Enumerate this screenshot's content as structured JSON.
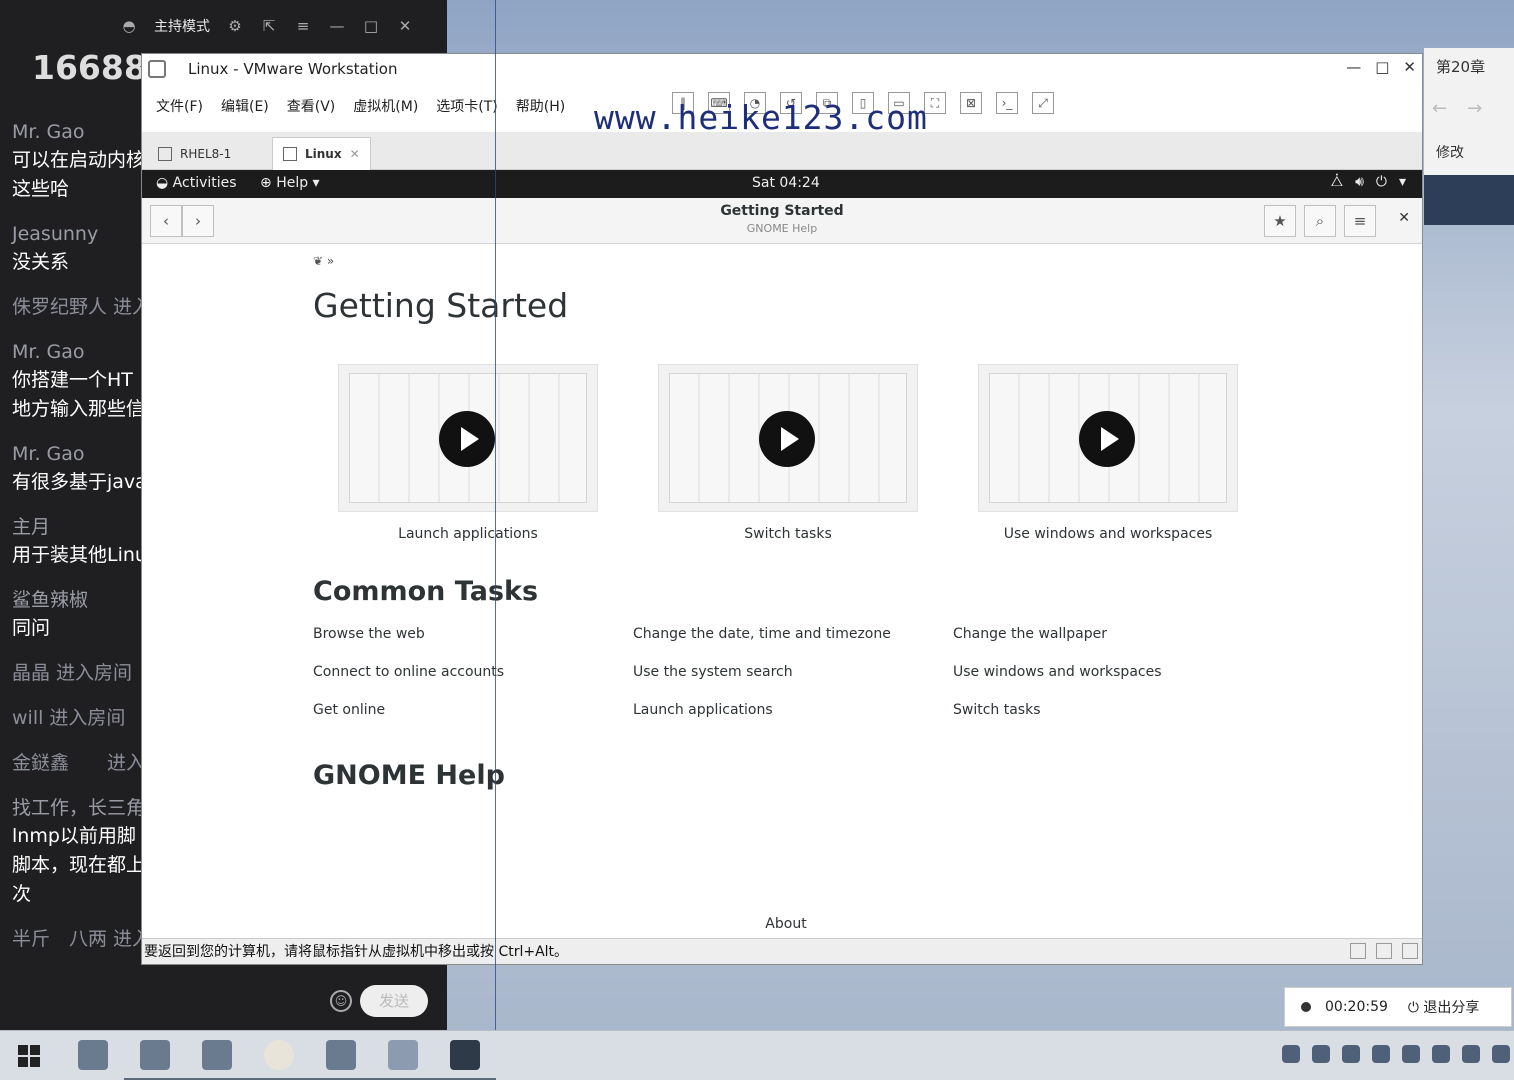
{
  "chat": {
    "toolbar_mode": "主持模式",
    "room_id": "16688",
    "messages": [
      {
        "user": "Mr. Gao",
        "text": "可以在启动内核",
        "text2": "这些哈"
      },
      {
        "user": "Jeasunny",
        "text": "没关系"
      },
      {
        "system": "侏罗纪野人 进入"
      },
      {
        "user": "Mr. Gao",
        "text": "你搭建一个HT",
        "text2": "地方输入那些信"
      },
      {
        "user": "Mr. Gao",
        "text": "有很多基于java"
      },
      {
        "user": "主月",
        "text": "用于装其他Linu"
      },
      {
        "user": "鲨鱼辣椒",
        "text": "同问"
      },
      {
        "system": "晶晶 进入房间"
      },
      {
        "system": "will 进入房间"
      },
      {
        "system": "金鎹鑫　　进入"
      },
      {
        "user": "找工作，长三角",
        "text": "lnmp以前用脚",
        "text2": "脚本，现在都上",
        "text3": "次"
      },
      {
        "system": "半斤　八两 进入"
      }
    ],
    "send_label": "发送"
  },
  "side_panel": {
    "title": "第20章",
    "edit_label": "修改"
  },
  "vmware": {
    "title": "Linux - VMware Workstation",
    "menu": [
      "文件(F)",
      "编辑(E)",
      "查看(V)",
      "虚拟机(M)",
      "选项卡(T)",
      "帮助(H)"
    ],
    "watermark": "www.heike123.com",
    "tabs": [
      {
        "label": "RHEL8-1"
      },
      {
        "label": "Linux"
      }
    ],
    "status_text": "要返回到您的计算机，请将鼠标指针从虚拟机中移出或按 Ctrl+Alt。"
  },
  "gnome": {
    "activities": "Activities",
    "help_menu": "Help ▾",
    "clock": "Sat 04:24"
  },
  "help_app": {
    "header_title": "Getting Started",
    "header_subtitle": "GNOME Help",
    "trail": "» ",
    "page_title": "Getting Started",
    "videos": [
      {
        "caption": "Launch applications"
      },
      {
        "caption": "Switch tasks"
      },
      {
        "caption": "Use windows and workspaces"
      }
    ],
    "common_tasks_title": "Common Tasks",
    "tasks": {
      "col1": [
        "Browse the web",
        "Connect to online accounts",
        "Get online"
      ],
      "col2": [
        "Change the date, time and timezone",
        "Use the system search",
        "Launch applications"
      ],
      "col3": [
        "Change the wallpaper",
        "Use windows and workspaces",
        "Switch tasks"
      ]
    },
    "gnome_help_title": "GNOME Help",
    "about": "About"
  },
  "recording": {
    "time": "00:20:59",
    "stop_label": "退出分享"
  }
}
